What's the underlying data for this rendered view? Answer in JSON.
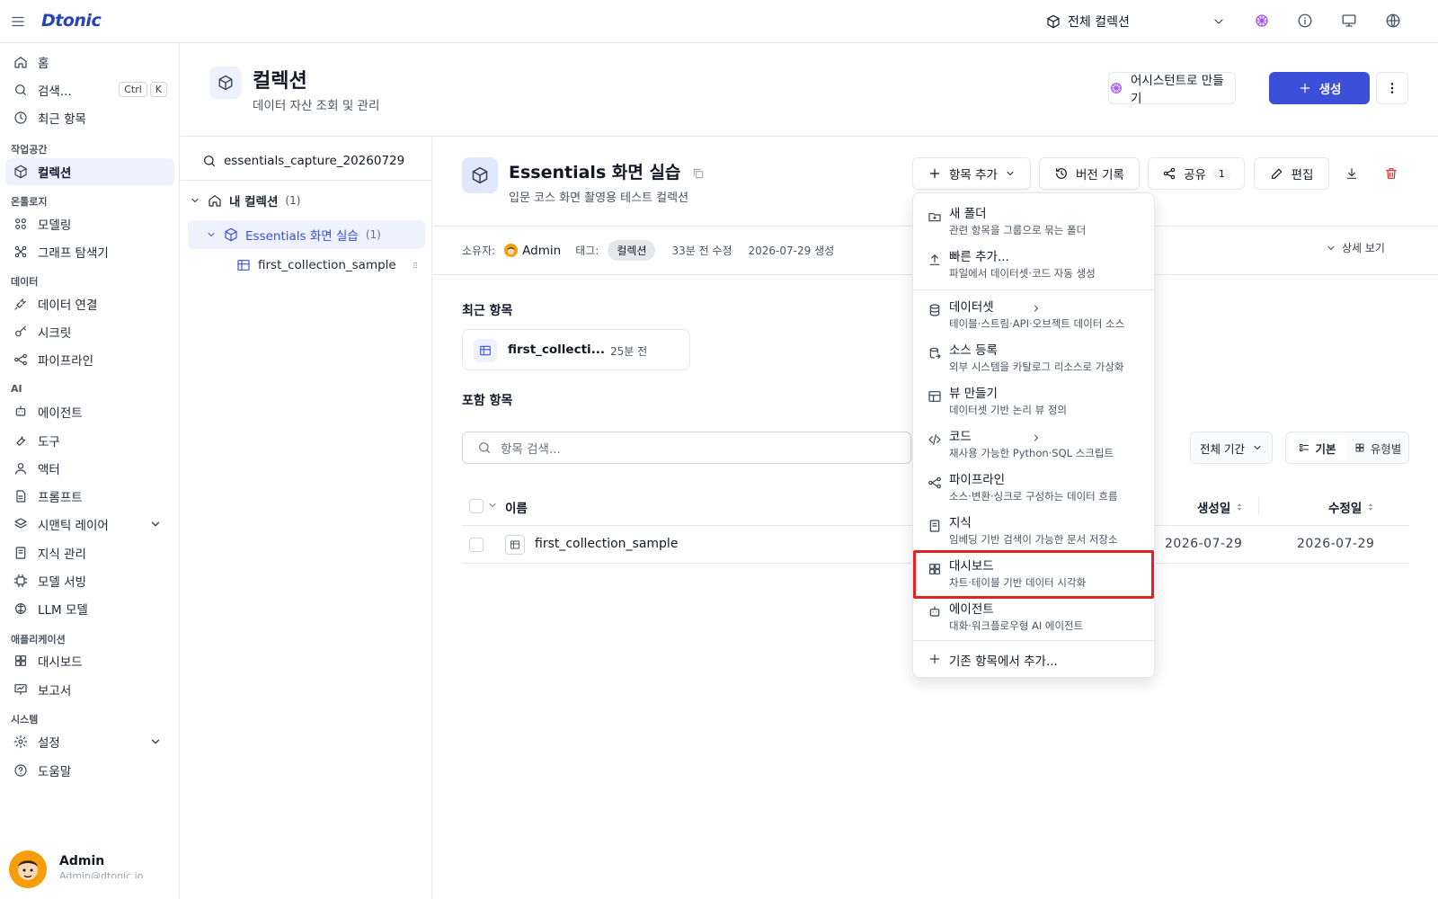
{
  "app": {
    "logo": "Dtonic",
    "collection_selector": "전체 컬렉션"
  },
  "sidebar": {
    "home": "홈",
    "search": "검색...",
    "search_kbd": [
      "Ctrl",
      "K"
    ],
    "recent": "최근 항목",
    "sections": {
      "workspace": "작업공간",
      "ontology": "온톨로지",
      "data": "데이터",
      "ai": "AI",
      "apps": "애플리케이션",
      "system": "시스템"
    },
    "items": {
      "collections": "컬렉션",
      "modeling": "모델링",
      "graph": "그래프 탐색기",
      "data_conn": "데이터 연결",
      "secrets": "시크릿",
      "pipeline": "파이프라인",
      "agent": "에이전트",
      "tools": "도구",
      "actor": "액터",
      "prompt": "프롬프트",
      "semantic": "시맨틱 레이어",
      "knowledge": "지식 관리",
      "model_serving": "모델 서빙",
      "llm": "LLM 모델",
      "dashboard": "대시보드",
      "report": "보고서",
      "settings": "설정",
      "help": "도움말"
    },
    "user": {
      "name": "Admin",
      "email": "Admin@dtonic.io"
    }
  },
  "header": {
    "title": "컬렉션",
    "subtitle": "데이터 자산 조회 및 관리",
    "assistant_btn": "어시스턴트로 만들기",
    "create_btn": "생성"
  },
  "tree": {
    "search_value": "essentials_capture_20260729",
    "root_label": "내 컬렉션",
    "root_count": "(1)",
    "child_label": "Essentials 화면 실습",
    "child_count": "(1)",
    "leaf_label": "first_collection_sample"
  },
  "collection": {
    "title": "Essentials 화면 실습",
    "subtitle": "입문 코스 화면 촬영용 테스트 컬렉션",
    "add_item": "항목 추가",
    "history": "버전 기록",
    "share": "공유",
    "share_count": "1",
    "edit": "편집",
    "owner_label": "소유자:",
    "owner": "Admin",
    "tag_label": "태그:",
    "tag": "컬렉션",
    "modified": "33분 전 수정",
    "created": "2026-07-29 생성",
    "details": "상세 보기",
    "recent_title": "최근 항목",
    "recent_card_name": "first_collecti...",
    "recent_card_time": "25분 전",
    "included_title": "포함 항목",
    "search_placeholder": "항목 검색...",
    "period_filter": "전체 기간",
    "view_basic": "기본",
    "view_type": "유형별",
    "columns": {
      "name": "이름",
      "created": "생성일",
      "modified": "수정일"
    },
    "rows": [
      {
        "name": "first_collection_sample",
        "created": "2026-07-29",
        "modified": "2026-07-29"
      }
    ]
  },
  "dropdown": {
    "items": [
      {
        "label": "새 폴더",
        "desc": "관련 항목을 그룹으로 묶는 폴더"
      },
      {
        "label": "빠른 추가...",
        "desc": "파일에서 데이터셋·코드 자동 생성"
      },
      {
        "label": "데이터셋",
        "desc": "테이블·스트림·API·오브젝트 데이터 소스"
      },
      {
        "label": "소스 등록",
        "desc": "외부 시스템을 카탈로그 리소스로 가상화"
      },
      {
        "label": "뷰 만들기",
        "desc": "데이터셋 기반 논리 뷰 정의"
      },
      {
        "label": "코드",
        "desc": "재사용 가능한 Python·SQL 스크립트"
      },
      {
        "label": "파이프라인",
        "desc": "소스·변환·싱크로 구성하는 데이터 흐름"
      },
      {
        "label": "지식",
        "desc": "임베딩 기반 검색이 가능한 문서 저장소"
      },
      {
        "label": "대시보드",
        "desc": "차트·테이블 기반 데이터 시각화"
      },
      {
        "label": "에이전트",
        "desc": "대화·워크플로우형 AI 에이전트"
      }
    ],
    "add_existing": "기존 항목에서 추가..."
  },
  "colors": {
    "primary": "#3b4fd8",
    "accent_violet": "#8b5cf6",
    "highlight": "#e02424",
    "danger": "#dc2626"
  }
}
